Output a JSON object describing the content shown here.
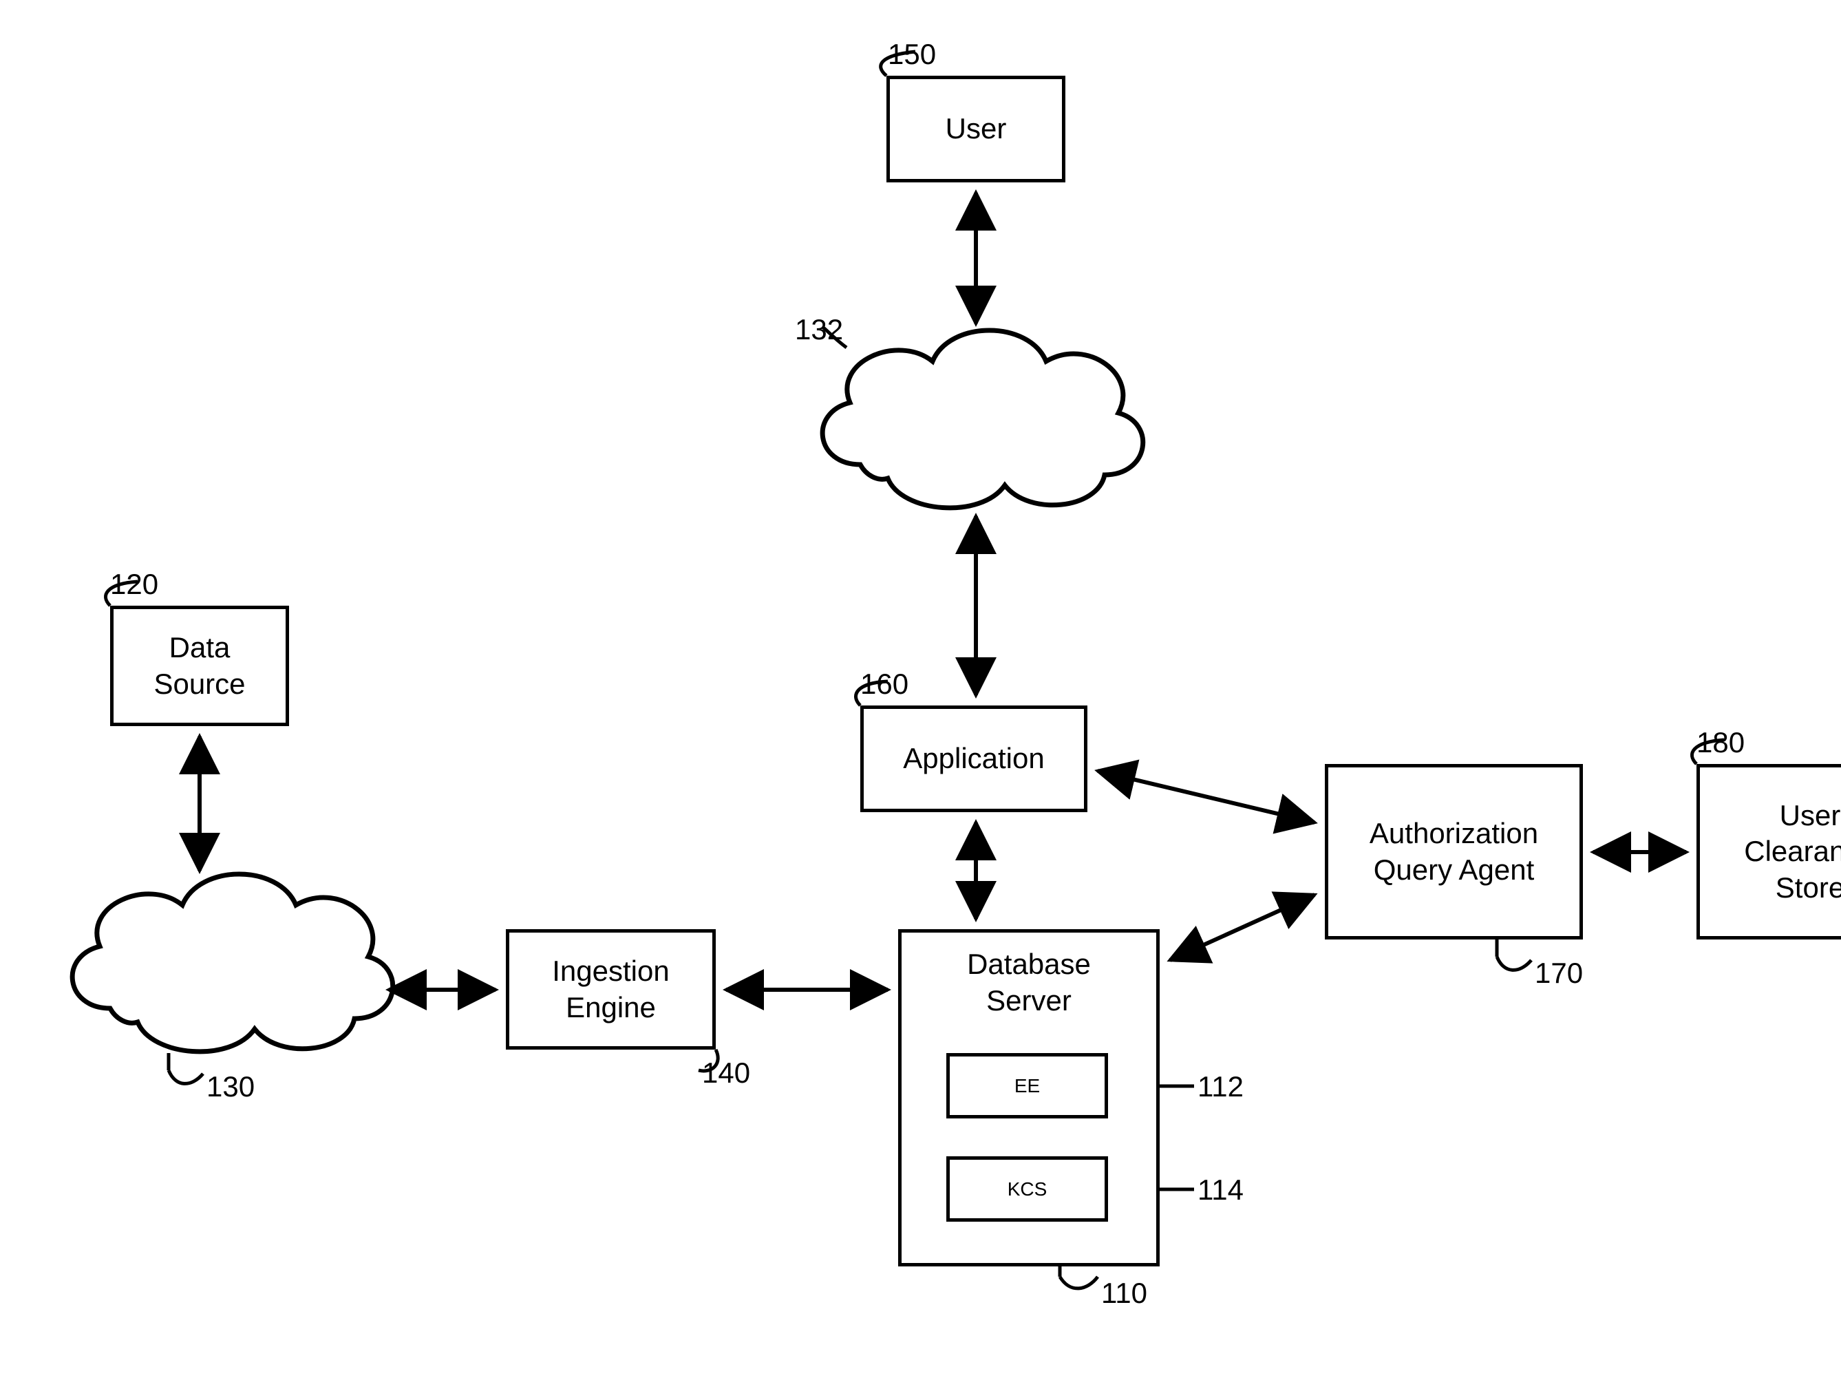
{
  "nodes": {
    "user": {
      "label": "User",
      "ref": "150"
    },
    "cloud_top": {
      "label": "",
      "ref": "132"
    },
    "data_source": {
      "label": "Data\nSource",
      "ref": "120"
    },
    "cloud_left": {
      "label": "",
      "ref": "130"
    },
    "ingestion_engine": {
      "label": "Ingestion\nEngine",
      "ref": "140"
    },
    "application": {
      "label": "Application",
      "ref": "160"
    },
    "database_server": {
      "label": "Database\nServer",
      "ref": "110"
    },
    "db_ee": {
      "label": "EE",
      "ref": "112"
    },
    "db_kcs": {
      "label": "KCS",
      "ref": "114"
    },
    "auth_query_agent": {
      "label": "Authorization\nQuery Agent",
      "ref": "170"
    },
    "user_clearance_store": {
      "label": "User\nClearance\nStore",
      "ref": "180"
    }
  }
}
